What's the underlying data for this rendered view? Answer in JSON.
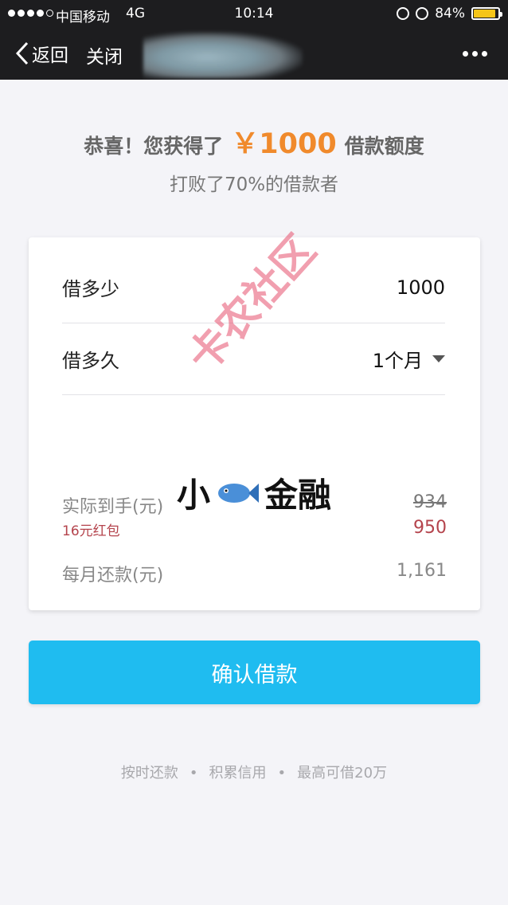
{
  "status_bar": {
    "carrier": "中国移动",
    "network": "4G",
    "time": "10:14",
    "battery": "84%",
    "battery_color": "#f5c518"
  },
  "nav": {
    "back_label": "返回",
    "close_label": "关闭",
    "more_icon": "more-horizontal-icon"
  },
  "headline": {
    "prefix": "恭喜！您获得了",
    "amount": "￥1000",
    "suffix": "借款额度",
    "amount_color": "#f08a2c"
  },
  "subline": "打败了70%的借款者",
  "form": {
    "amount_label": "借多少",
    "amount_value": "1000",
    "term_label": "借多久",
    "term_value": "1个月"
  },
  "summary": {
    "received_label": "实际到手(元)",
    "received_original": "934",
    "bonus_label": "16元红包",
    "received_value": "950",
    "monthly_label": "每月还款(元)",
    "monthly_value": "1,161"
  },
  "watermark": {
    "community": "卡农社区",
    "brand_left": "小",
    "brand_right": "金融"
  },
  "confirm_button": {
    "label": "确认借款",
    "color": "#1fbcf0"
  },
  "footer": {
    "item1": "按时还款",
    "item2": "积累信用",
    "item3": "最高可借20万",
    "separator": "•"
  }
}
